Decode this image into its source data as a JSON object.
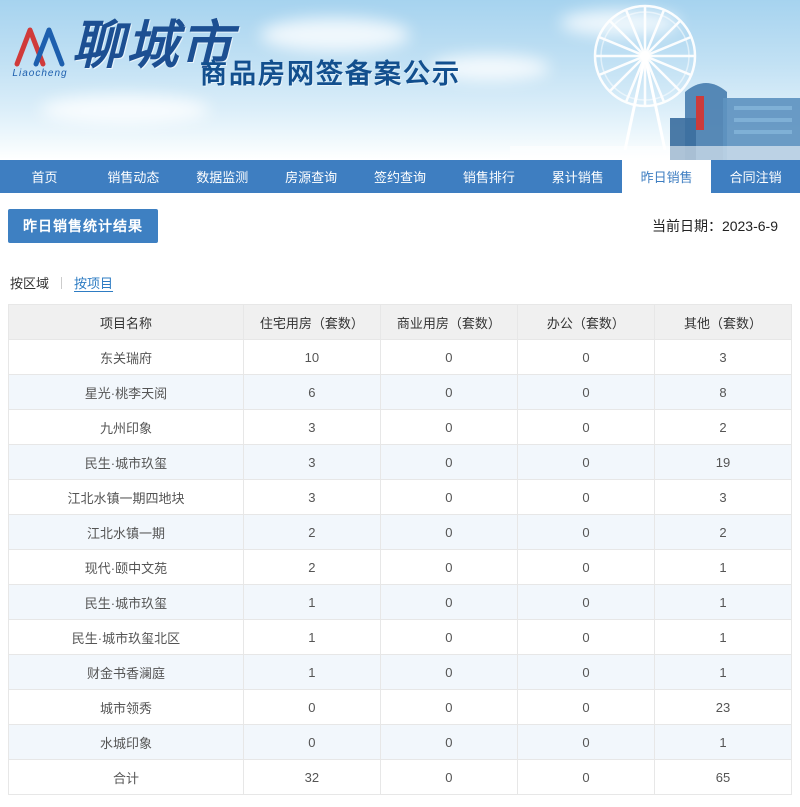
{
  "banner": {
    "logo_city": "聊城市",
    "logo_sub": "Liaocheng",
    "title": "商品房网签备案公示"
  },
  "nav": {
    "items": [
      {
        "name": "home",
        "label": "首页",
        "active": false
      },
      {
        "name": "sales-news",
        "label": "销售动态",
        "active": false
      },
      {
        "name": "data-monitor",
        "label": "数据监测",
        "active": false
      },
      {
        "name": "listing-query",
        "label": "房源查询",
        "active": false
      },
      {
        "name": "contract-query",
        "label": "签约查询",
        "active": false
      },
      {
        "name": "sales-ranking",
        "label": "销售排行",
        "active": false
      },
      {
        "name": "total-sales",
        "label": "累计销售",
        "active": false
      },
      {
        "name": "yesterday-sales",
        "label": "昨日销售",
        "active": true
      },
      {
        "name": "contract-cancel",
        "label": "合同注销",
        "active": false
      }
    ]
  },
  "page": {
    "title": "昨日销售统计结果",
    "date_label": "当前日期：2023-6-9"
  },
  "tabs": [
    {
      "name": "by-region",
      "label": "按区域",
      "active": false
    },
    {
      "name": "by-project",
      "label": "按项目",
      "active": true
    }
  ],
  "table": {
    "headers": [
      "项目名称",
      "住宅用房（套数）",
      "商业用房（套数）",
      "办公（套数）",
      "其他（套数）"
    ],
    "rows": [
      [
        "东关瑞府",
        "10",
        "0",
        "0",
        "3"
      ],
      [
        "星光·桃李天阅",
        "6",
        "0",
        "0",
        "8"
      ],
      [
        "九州印象",
        "3",
        "0",
        "0",
        "2"
      ],
      [
        "民生·城市玖玺",
        "3",
        "0",
        "0",
        "19"
      ],
      [
        "江北水镇一期四地块",
        "3",
        "0",
        "0",
        "3"
      ],
      [
        "江北水镇一期",
        "2",
        "0",
        "0",
        "2"
      ],
      [
        "现代·颐中文苑",
        "2",
        "0",
        "0",
        "1"
      ],
      [
        "民生·城市玖玺",
        "1",
        "0",
        "0",
        "1"
      ],
      [
        "民生·城市玖玺北区",
        "1",
        "0",
        "0",
        "1"
      ],
      [
        "财金书香澜庭",
        "1",
        "0",
        "0",
        "1"
      ],
      [
        "城市领秀",
        "0",
        "0",
        "0",
        "23"
      ],
      [
        "水城印象",
        "0",
        "0",
        "0",
        "1"
      ],
      [
        "合计",
        "32",
        "0",
        "0",
        "65"
      ]
    ]
  },
  "colors": {
    "nav_blue": "#3e7ec1",
    "accent_blue": "#3e80c2",
    "banner_sky": "#a6d3ef",
    "table_alt_row": "#f2f7fc",
    "table_header_bg": "#f0f0f0"
  }
}
